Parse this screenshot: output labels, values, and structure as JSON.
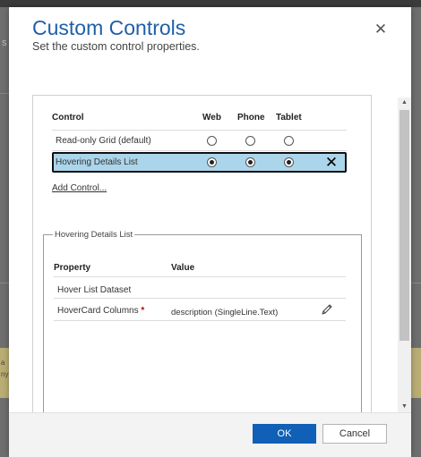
{
  "background": {
    "fragment_s": "S",
    "fragment_a": "a",
    "fragment_y": "ny"
  },
  "dialog": {
    "title": "Custom Controls",
    "subtitle": "Set the custom control properties.",
    "close_glyph": "✕"
  },
  "controls": {
    "headers": {
      "control": "Control",
      "web": "Web",
      "phone": "Phone",
      "tablet": "Tablet"
    },
    "rows": [
      {
        "label": "Read-only Grid (default)",
        "web": false,
        "phone": false,
        "tablet": false
      },
      {
        "label": "Hovering Details List",
        "web": true,
        "phone": true,
        "tablet": true,
        "selected": true,
        "remove_glyph": "✕"
      }
    ],
    "add_control_label": "Add Control..."
  },
  "properties": {
    "legend": "Hovering Details List",
    "headers": {
      "property": "Property",
      "value": "Value"
    },
    "rows": [
      {
        "property": "Hover List Dataset",
        "value": ""
      },
      {
        "property": "HoverCard Columns",
        "required_mark": "*",
        "value": "description (SingleLine.Text)"
      }
    ]
  },
  "scrollbar": {
    "up_glyph": "▲",
    "down_glyph": "▼"
  },
  "footer": {
    "ok_label": "OK",
    "cancel_label": "Cancel"
  },
  "colors": {
    "accent": "#1160b7",
    "title": "#1f5fa8",
    "selected_row": "#abd5ea",
    "required": "#c00000"
  }
}
